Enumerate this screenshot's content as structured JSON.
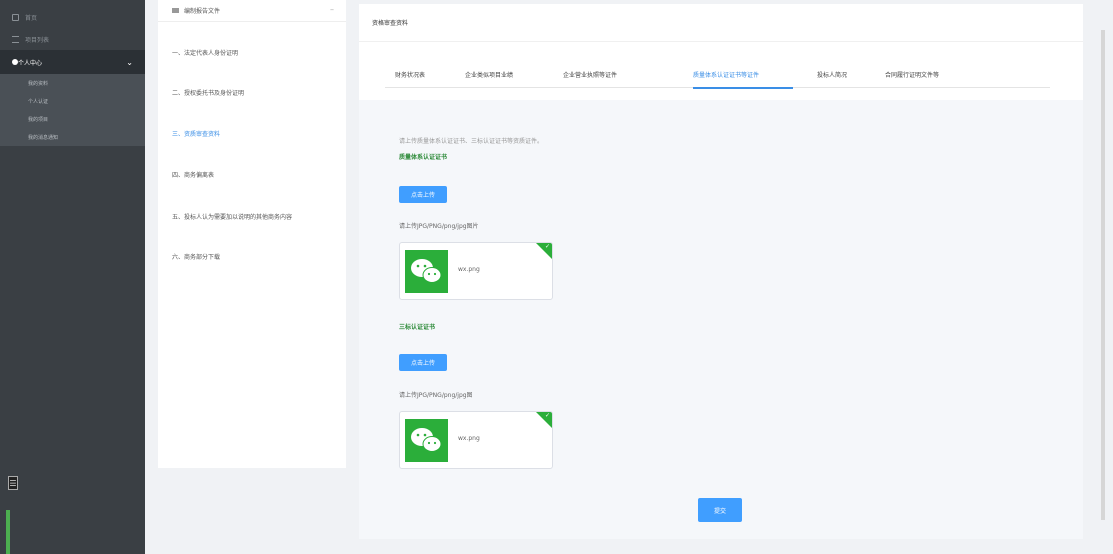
{
  "sidebar": {
    "items": [
      {
        "label": "首页"
      },
      {
        "label": "项目列表"
      }
    ],
    "parent": {
      "label": "个人中心"
    },
    "children": [
      {
        "label": "我的资料"
      },
      {
        "label": "个人认证"
      },
      {
        "label": "我的项目"
      },
      {
        "label": "我的消息通知"
      }
    ],
    "bottom_icon": "☰"
  },
  "navcol": {
    "header": "编制报告文件",
    "items": [
      {
        "label": "一、法定代表人身份证明"
      },
      {
        "label": "二、授权委托书及身份证明"
      },
      {
        "label": "三、资质审查资料"
      },
      {
        "label": "四、商务偏离表"
      },
      {
        "label": "五、投标人认为需要加以说明的其他商务内容"
      },
      {
        "label": "六、商务部分下载"
      }
    ]
  },
  "main": {
    "title": "资格审查资料",
    "tabs": [
      {
        "label": "财务状况表"
      },
      {
        "label": "企业类似项目业绩"
      },
      {
        "label": "企业营业执照等证件"
      },
      {
        "label": "质量体系认证证书等证件"
      },
      {
        "label": "投标人简况"
      },
      {
        "label": "合同履行证明文件等"
      }
    ],
    "hint": "请上传质量体系认证证书、三标认证证书等资质证件。",
    "sections": [
      {
        "title": "质量体系认证证书",
        "upload_label": "点击上传",
        "note": "请上传JPG/PNG/png/jpg图片",
        "file_name": "wx.png"
      },
      {
        "title": "三标认证证书",
        "upload_label": "点击上传",
        "note": "请上传JPG/PNG/png/jpg图",
        "file_name": "wx.png"
      }
    ],
    "submit_label": "提交"
  },
  "colors": {
    "accent": "#409eff",
    "sidebar_bg": "#3a3f44",
    "success": "#2bae3a"
  }
}
